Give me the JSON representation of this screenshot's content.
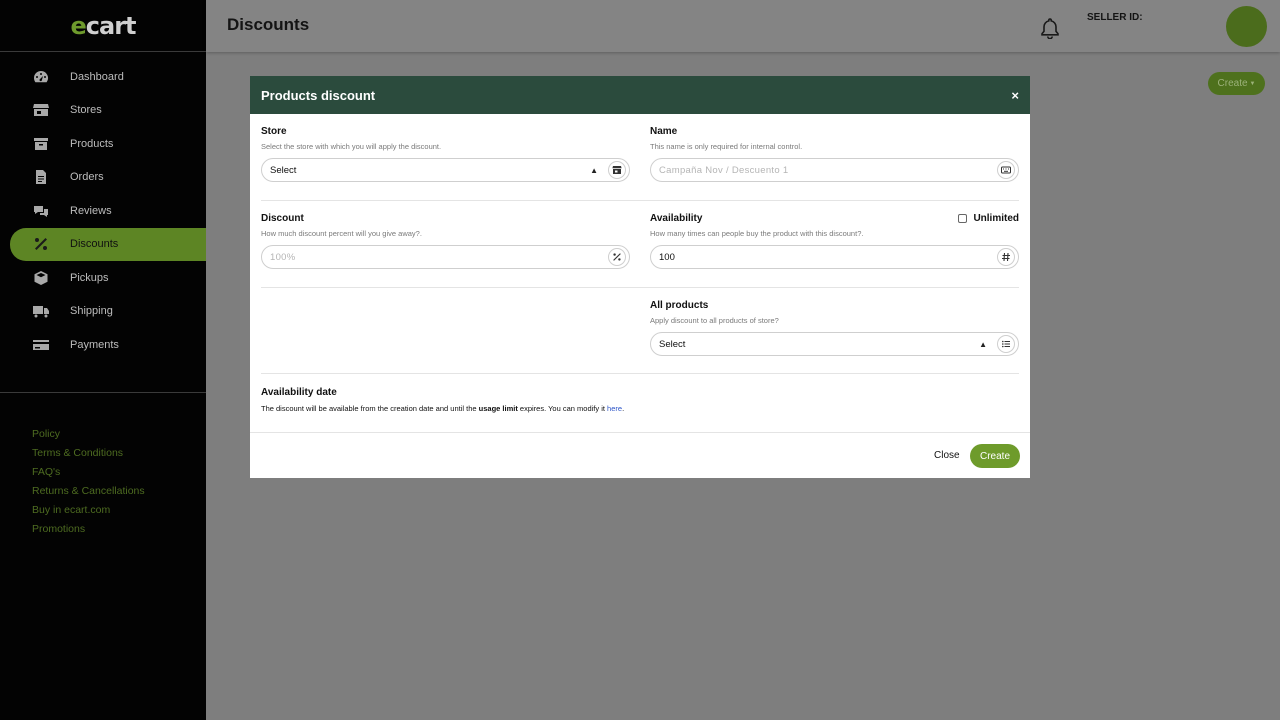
{
  "brand": {
    "logo_prefix": "e",
    "logo_rest": "cart"
  },
  "sidebar": {
    "items": [
      {
        "label": "Dashboard",
        "icon": "dashboard-icon"
      },
      {
        "label": "Stores",
        "icon": "store-icon"
      },
      {
        "label": "Products",
        "icon": "box-icon"
      },
      {
        "label": "Orders",
        "icon": "document-icon"
      },
      {
        "label": "Reviews",
        "icon": "chat-icon"
      },
      {
        "label": "Discounts",
        "icon": "percent-icon",
        "active": true
      },
      {
        "label": "Pickups",
        "icon": "cube-icon"
      },
      {
        "label": "Shipping",
        "icon": "truck-icon"
      },
      {
        "label": "Payments",
        "icon": "credit-card-icon"
      }
    ],
    "footer_links": [
      "Policy",
      "Terms & Conditions",
      "FAQ's",
      "Returns & Cancellations",
      "Buy in ecart.com",
      "Promotions"
    ]
  },
  "header": {
    "title": "Discounts",
    "seller_label": "SELLER ID:",
    "create_label": "Create"
  },
  "modal": {
    "title": "Products discount",
    "close_icon": "×",
    "store": {
      "label": "Store",
      "help": "Select the store with which you will apply the discount.",
      "value": "Select"
    },
    "name": {
      "label": "Name",
      "help": "This name is only required for internal control.",
      "placeholder": "Campaña Nov / Descuento 1"
    },
    "discount": {
      "label": "Discount",
      "help": "How much discount percent will you give away?.",
      "placeholder": "100%"
    },
    "availability": {
      "label": "Availability",
      "help": "How many times can people buy the product with this discount?.",
      "value": "100",
      "unlimited_label": "Unlimited"
    },
    "all_products": {
      "label": "All products",
      "help": "Apply discount to all products of store?",
      "value": "Select"
    },
    "availability_date": {
      "label": "Availability date",
      "text_before": "The discount will be available from the creation date and until the ",
      "text_bold": "usage limit",
      "text_after": " expires. You can modify it ",
      "link": "here",
      "text_end": "."
    },
    "close_label": "Close",
    "create_label": "Create"
  },
  "colors": {
    "accent": "#6e9b2b",
    "header": "#2b4b3d",
    "sidebar": "#030303"
  }
}
